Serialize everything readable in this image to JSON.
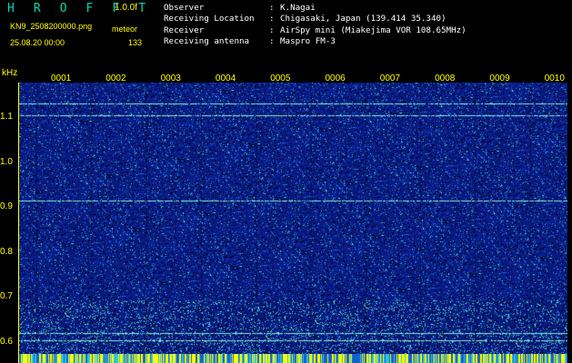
{
  "header": {
    "title": "H R O F F T",
    "version": "1.0.0f",
    "filename": "KN9_2508200000.png",
    "datetime": "25.08.20 00:00",
    "mode": "meteor",
    "count": "133"
  },
  "info": [
    {
      "label": "Observer",
      "sep": ":",
      "value": "K.Nagai"
    },
    {
      "label": "Receiving Location",
      "sep": ":",
      "value": "Chigasaki, Japan (139.414 35.340)"
    },
    {
      "label": "Receiver",
      "sep": ":",
      "value": "AirSpy mini (Miakejima VOR 108.65MHz)"
    },
    {
      "label": "Receiving antenna",
      "sep": ":",
      "value": "Maspro FM-3"
    }
  ],
  "axes": {
    "unit": "kHz",
    "y_ticks": [
      {
        "value": 1.1,
        "label": "1.1"
      },
      {
        "value": 1.0,
        "label": "1.0"
      },
      {
        "value": 0.9,
        "label": "0.9"
      },
      {
        "value": 0.8,
        "label": "0.8"
      },
      {
        "value": 0.7,
        "label": "0.7"
      },
      {
        "value": 0.6,
        "label": "0.6"
      }
    ],
    "x_ticks": [
      "0001",
      "0002",
      "0003",
      "0004",
      "0005",
      "0006",
      "0007",
      "0008",
      "0009",
      "0010"
    ]
  },
  "colors": {
    "background": "#000000",
    "label": "#ffff00",
    "title": "#00d8b0",
    "spectrum_base": "#0a1a78",
    "carrier_line": "#7ff0d0"
  },
  "carrier_lines_khz": [
    1.13,
    1.105,
    0.915,
    0.62,
    0.605
  ]
}
